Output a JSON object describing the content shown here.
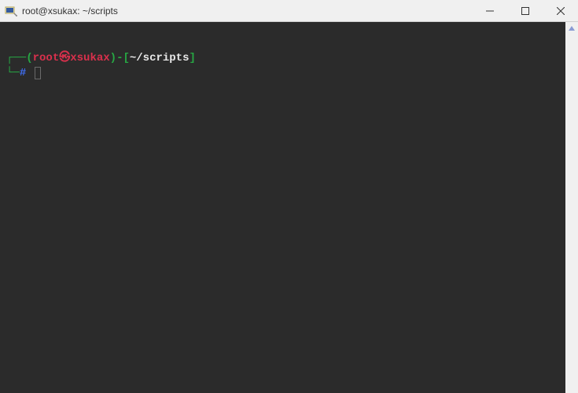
{
  "window": {
    "title": "root@xsukax: ~/scripts"
  },
  "prompt": {
    "line1_open_paren": "(",
    "user": "root",
    "skull": "㉿",
    "host": "xsukax",
    "line1_close_paren": ")",
    "dash": "-",
    "path_open": "[",
    "path": "~/scripts",
    "path_close": "]",
    "hash": "#"
  }
}
